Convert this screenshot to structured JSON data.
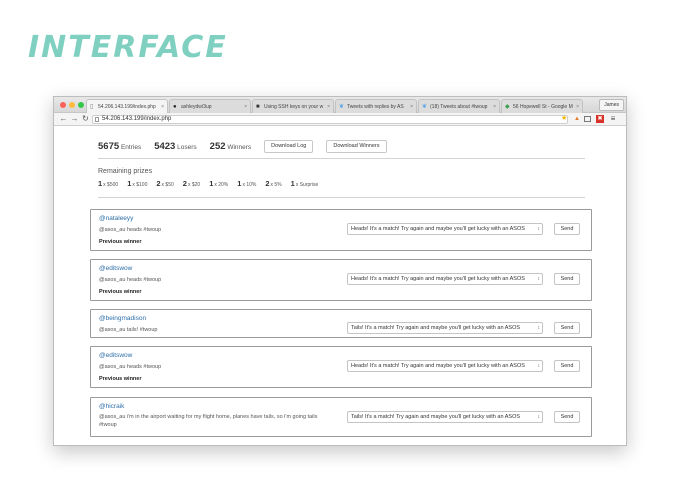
{
  "heading": "INTERFACE",
  "browser": {
    "tabs": [
      {
        "icon": "page-icon",
        "title": "54.206.143.199/index.php",
        "active": true
      },
      {
        "icon": "github-icon",
        "title": "ashleydw/3up",
        "active": false
      },
      {
        "icon": "terminal-icon",
        "title": "Using SSH keys on your w",
        "active": false
      },
      {
        "icon": "twitter-icon",
        "title": "Tweets with replies by AS",
        "active": false
      },
      {
        "icon": "twitter-icon",
        "title": "(18) Tweets about #twoup",
        "active": false
      },
      {
        "icon": "maps-icon",
        "title": "56 Hopewell St - Google M",
        "active": false
      }
    ],
    "profile": "James",
    "url": "54.206.143.199/index.php"
  },
  "stats": {
    "entries_value": "5675",
    "entries_label": "Entries",
    "losers_value": "5423",
    "losers_label": "Losers",
    "winners_value": "252",
    "winners_label": "Winners",
    "download_log": "Download Log",
    "download_winners": "Download Winners"
  },
  "prizes": {
    "title": "Remaining prizes",
    "items": [
      {
        "count": "1",
        "desc": "x $500"
      },
      {
        "count": "1",
        "desc": "x $100"
      },
      {
        "count": "2",
        "desc": "x $50"
      },
      {
        "count": "2",
        "desc": "x $20"
      },
      {
        "count": "1",
        "desc": "x 20%"
      },
      {
        "count": "1",
        "desc": "x 10%"
      },
      {
        "count": "2",
        "desc": "x 5%"
      },
      {
        "count": "1",
        "desc": "x Surprise"
      }
    ]
  },
  "entries": [
    {
      "handle": "@nataleeyy",
      "message": "@asos_au heads #twoup",
      "previous": "Previous winner",
      "reply": "Heads! It's a match! Try again and maybe you'll get lucky with an ASOS",
      "send": "Send"
    },
    {
      "handle": "@editswow",
      "message": "@asos_au heads #twoup",
      "previous": "Previous winner",
      "reply": "Heads! It's a match! Try again and maybe you'll get lucky with an ASOS",
      "send": "Send"
    },
    {
      "handle": "@beingmadison",
      "message": "@asos_au tails! #twoup",
      "previous": "",
      "reply": "Tails! It's a match! Try again and maybe you'll get lucky with an ASOS",
      "send": "Send"
    },
    {
      "handle": "@editswow",
      "message": "@asos_au heads #twoup",
      "previous": "Previous winner",
      "reply": "Heads! It's a match! Try again and maybe you'll get lucky with an ASOS",
      "send": "Send"
    },
    {
      "handle": "@hicraik",
      "message": "@asos_au i'm in the airport waiting for my flight home, planes have tails, so i'm going tails #twoup",
      "previous": "",
      "reply": "Tails! It's a match! Try again and maybe you'll get lucky with an ASOS",
      "send": "Send"
    }
  ]
}
